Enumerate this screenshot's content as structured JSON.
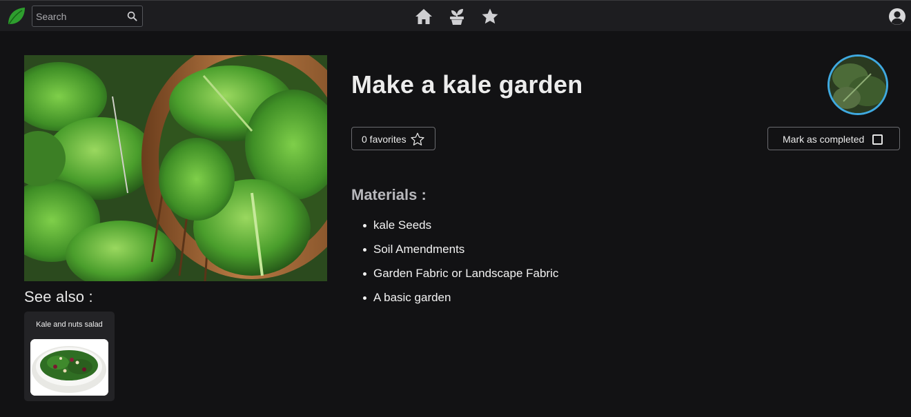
{
  "nav": {
    "search_placeholder": "Search",
    "icons": [
      "leaf-logo-icon",
      "search-icon",
      "home-icon",
      "plant-pot-icon",
      "star-icon",
      "user-account-icon"
    ]
  },
  "project": {
    "title": "Make a kale garden",
    "favorites_label": "0 favorites",
    "completed_label": "Mark as completed",
    "completed": false
  },
  "materials": {
    "heading": "Materials :",
    "items": [
      "kale Seeds",
      "Soil Amendments",
      "Garden Fabric or Landscape Fabric",
      "A basic garden"
    ]
  },
  "see_also": {
    "heading": "See also :",
    "cards": [
      {
        "title": "Kale and nuts salad"
      }
    ]
  },
  "colors": {
    "background": "#121214",
    "topbar": "#1d1d20",
    "avatar_ring": "#3fa9e0",
    "logo_green": "#2e9e2e"
  }
}
